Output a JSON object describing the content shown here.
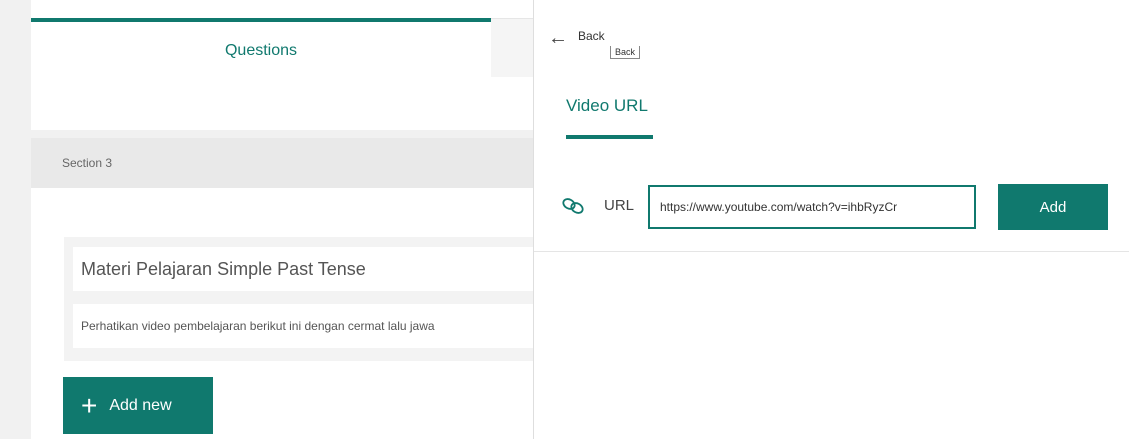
{
  "editor": {
    "tabs": [
      {
        "label": "Questions",
        "active": true
      }
    ],
    "section": {
      "label": "Section 3"
    },
    "question": {
      "title": "Materi Pelajaran Simple Past Tense",
      "description": "Perhatikan video pembelajaran berikut ini dengan cermat lalu jawa"
    },
    "add_new_label": "Add new",
    "add_new_icon": "plus-icon"
  },
  "panel": {
    "back_label": "Back",
    "back_tooltip": "Back",
    "back_icon": "arrow-left-icon",
    "tab_label": "Video URL",
    "url_label": "URL",
    "url_icon": "link-icon",
    "url_value": "https://www.youtube.com/watch?v=ihbRyzCr",
    "add_label": "Add"
  },
  "colors": {
    "accent": "#10796e",
    "background": "#f1f1f1"
  }
}
